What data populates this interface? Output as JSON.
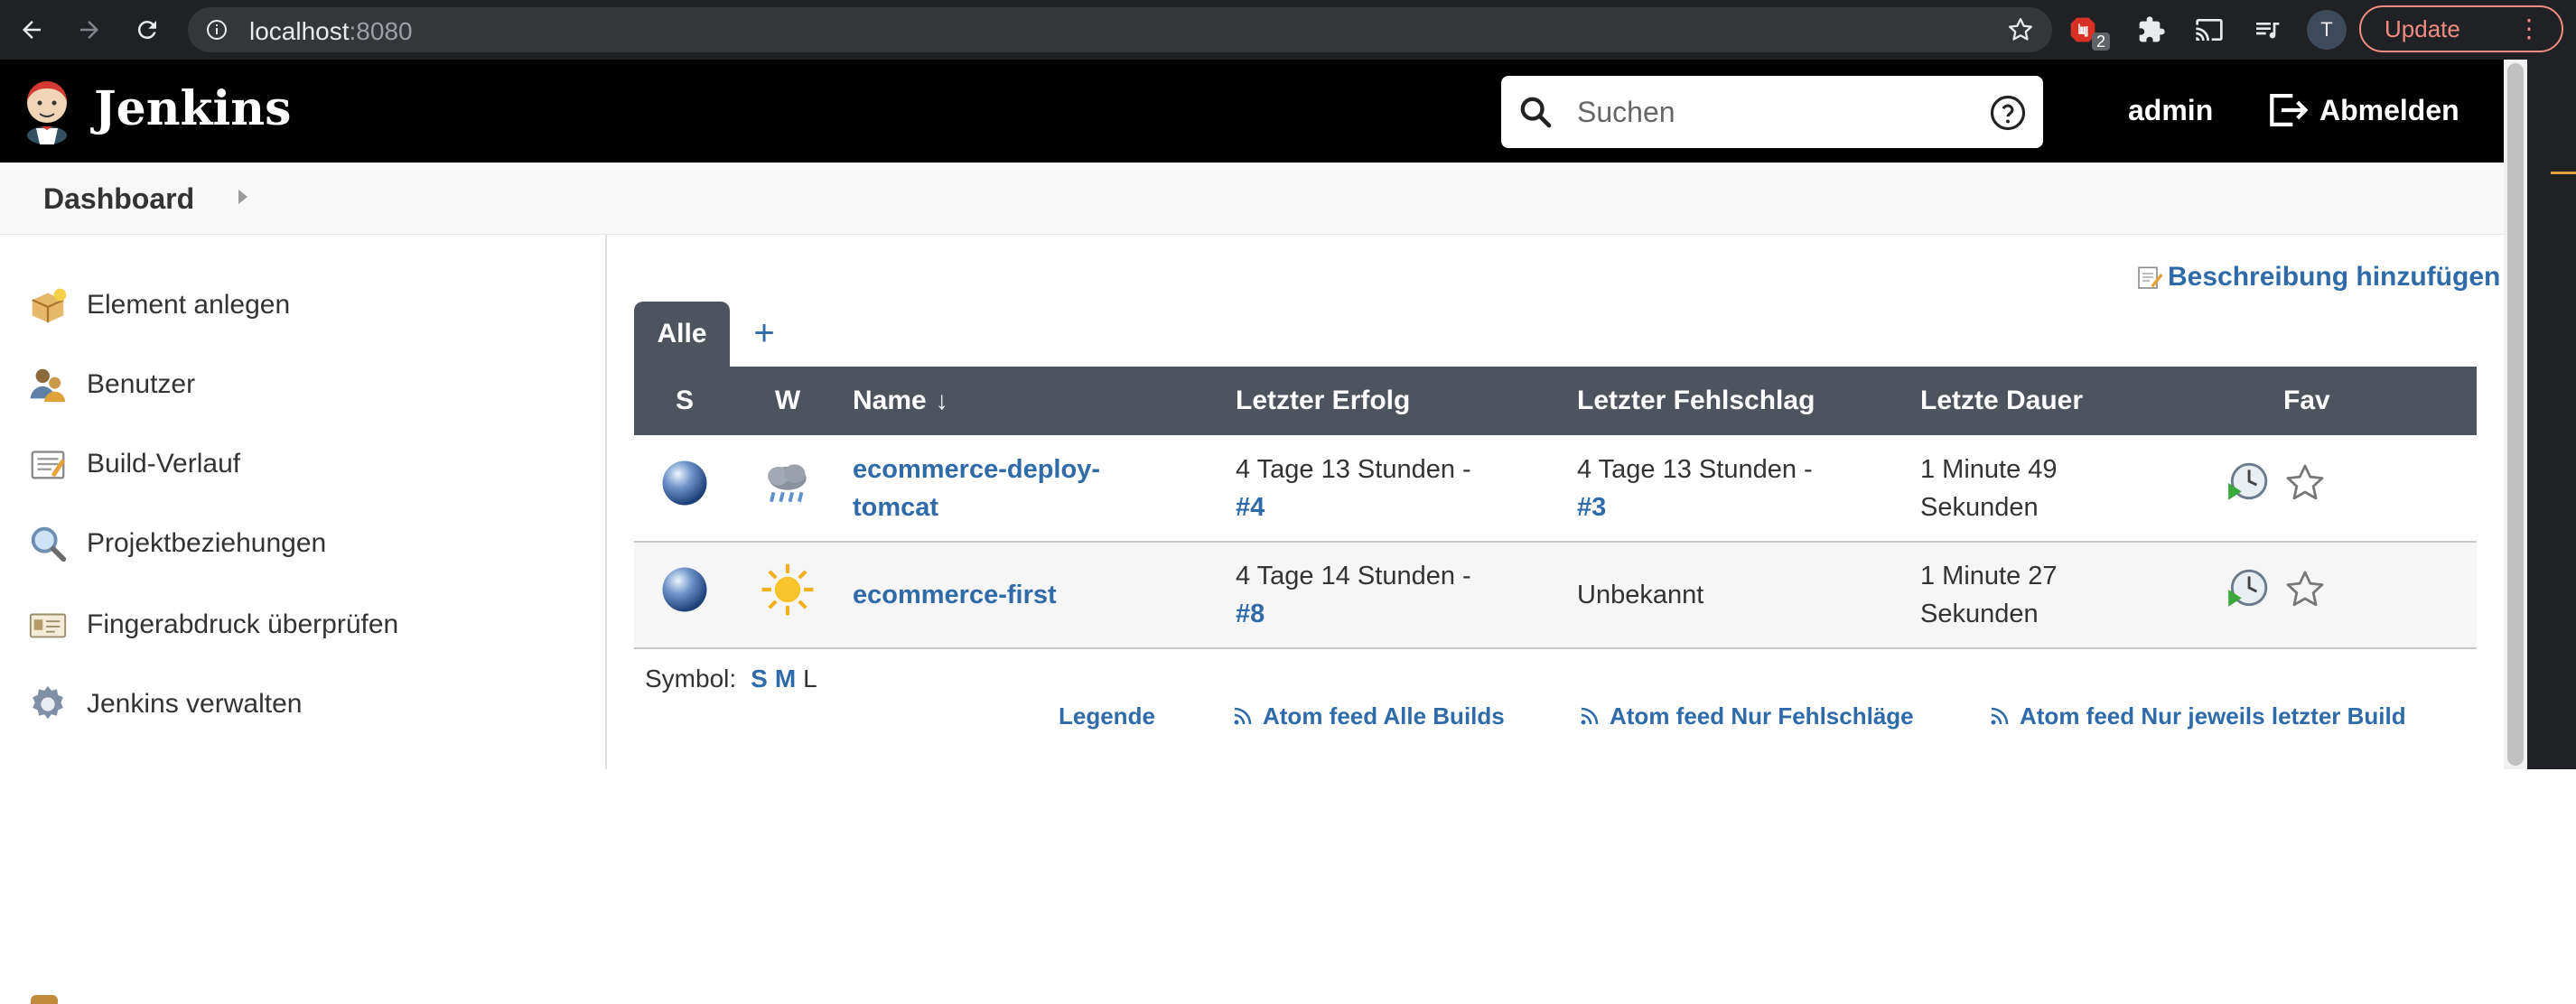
{
  "browser": {
    "url_host": "localhost",
    "url_port": ":8080",
    "extension_badge": "2",
    "profile_initial": "T",
    "update_label": "Update"
  },
  "header": {
    "brand": "Jenkins",
    "search_placeholder": "Suchen",
    "user": "admin",
    "logout_label": "Abmelden"
  },
  "breadcrumb": {
    "items": [
      "Dashboard"
    ]
  },
  "sidebar": {
    "items": [
      {
        "label": "Element anlegen",
        "icon": "new-item-icon"
      },
      {
        "label": "Benutzer",
        "icon": "users-icon"
      },
      {
        "label": "Build-Verlauf",
        "icon": "build-history-icon"
      },
      {
        "label": "Projektbeziehungen",
        "icon": "magnifier-icon"
      },
      {
        "label": "Fingerabdruck überprüfen",
        "icon": "fingerprint-card-icon"
      },
      {
        "label": "Jenkins verwalten",
        "icon": "gear-icon"
      }
    ]
  },
  "main": {
    "add_description": "Beschreibung hinzufügen",
    "tabs": [
      {
        "label": "Alle",
        "active": true
      }
    ],
    "add_tab": "+",
    "table": {
      "columns": [
        "S",
        "W",
        "Name",
        "Letzter Erfolg",
        "Letzter Fehlschlag",
        "Letzte Dauer",
        "Fav"
      ],
      "sort_indicator": "↓",
      "rows": [
        {
          "status": "blue-ball",
          "weather": "cloud-rain",
          "name": "ecommerce-deploy-tomcat",
          "last_success": "4 Tage 13 Stunden -",
          "last_success_build": "#4",
          "last_failure": "4 Tage 13 Stunden -",
          "last_failure_build": "#3",
          "last_duration": "1 Minute 49 Sekunden"
        },
        {
          "status": "blue-ball",
          "weather": "sunny",
          "name": "ecommerce-first",
          "last_success": "4 Tage 14 Stunden -",
          "last_success_build": "#8",
          "last_failure": "Unbekannt",
          "last_failure_build": "",
          "last_duration": "1 Minute 27 Sekunden"
        }
      ]
    },
    "symbol_label": "Symbol:",
    "symbol_sizes": [
      "S",
      "M",
      "L"
    ],
    "footer_links": [
      "Legende",
      "Atom feed Alle Builds",
      "Atom feed Nur Fehlschläge",
      "Atom feed Nur jeweils letzter Build"
    ]
  },
  "colors": {
    "link": "#2f6ba8",
    "header_bg": "#000000",
    "table_header_bg": "#4d545d",
    "update_accent": "#f28b82"
  }
}
